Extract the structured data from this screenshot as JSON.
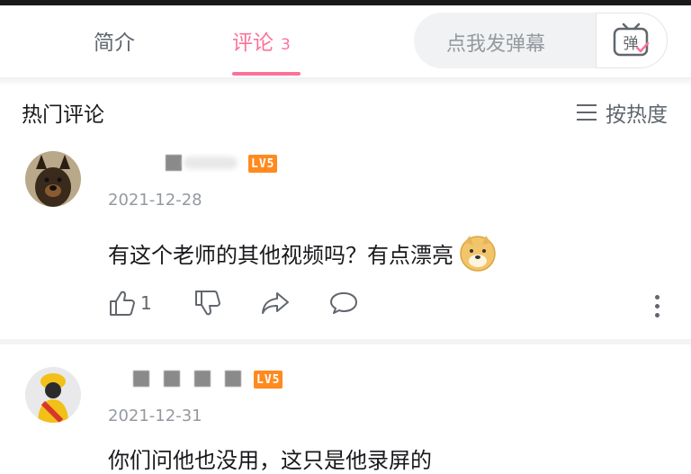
{
  "tabs": {
    "intro_label": "简介",
    "comments_label": "评论",
    "comments_count": "3"
  },
  "danmaku": {
    "placeholder": "点我发弹幕",
    "button_label": "弹"
  },
  "section": {
    "title": "热门评论",
    "sort_label": "按热度"
  },
  "comments": [
    {
      "level": "LV5",
      "date": "2021-12-28",
      "text": "有这个老师的其他视频吗？有点漂亮",
      "likes": "1"
    },
    {
      "level": "LV5",
      "date": "2021-12-31",
      "text": "你们问他也没用，这只是他录屏的"
    }
  ],
  "colors": {
    "accent": "#fb7299",
    "level_badge": "#ff8a1f",
    "muted": "#9499a0"
  }
}
